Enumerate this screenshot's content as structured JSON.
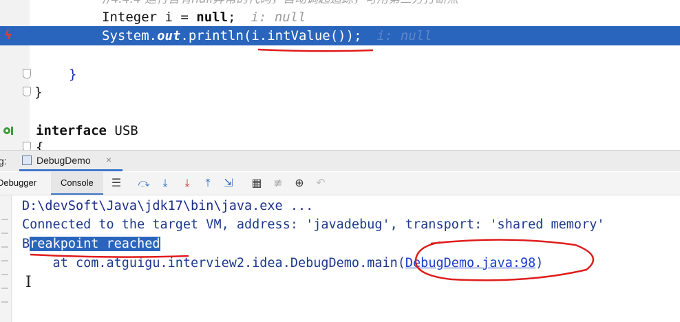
{
  "editor": {
    "comment_line": "//4.4.4 运行含有null异常的代码，自动调起追踪，可用第三方打断点",
    "decl": {
      "type": "Integer",
      "var": " i = ",
      "kw": "null",
      "end": ";",
      "hint": "i: null"
    },
    "current": {
      "prefix": "System.",
      "field": "out",
      "call": ".println(i.intValue());",
      "hint": "i: null"
    },
    "close_inner": "}",
    "close_outer": "}",
    "interface_kw": "interface",
    "interface_name": " USB",
    "next_brace": "{"
  },
  "tool_window": {
    "prefix": "g:",
    "tab_label": "DebugDemo",
    "debugger_label": "Debugger",
    "console_label": "Console"
  },
  "console": {
    "line1": "D:\\devSoft\\Java\\jdk17\\bin\\java.exe ...",
    "line2": "Connected to the target VM, address: 'javadebug', transport: 'shared memory'",
    "line3_first": "B",
    "line3_selected": "reakpoint reached",
    "line4_prefix": "    at com.atguigu.interview2.idea.DebugDemo.main(",
    "line4_link": "DebugDemo.java:98",
    "line4_suffix": ")",
    "cursor": "I"
  },
  "colors": {
    "highlight": "#2a65bd",
    "annotation": "#e01b1b",
    "keyword": "#111111",
    "link": "#1a3ec8"
  }
}
